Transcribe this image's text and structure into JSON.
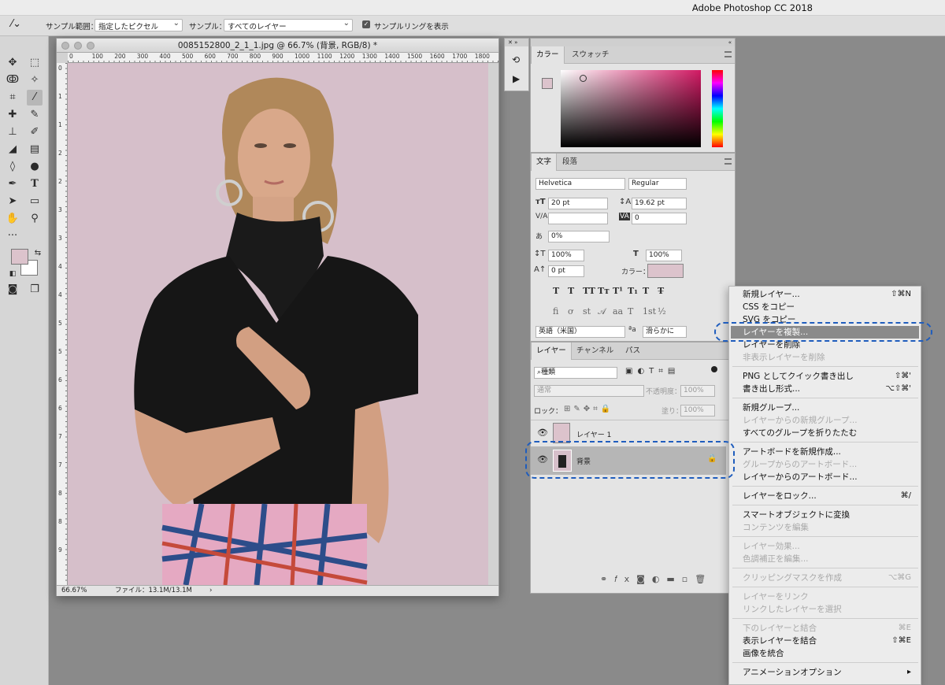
{
  "app_title": "Adobe Photoshop CC 2018",
  "options": {
    "sample_size_label": "サンプル範囲：",
    "sample_size_value": "指定したピクセル",
    "sample_label": "サンプル：",
    "sample_value": "すべてのレイヤー",
    "show_ring_label": "サンプルリングを表示"
  },
  "document": {
    "title": "0085152800_2_1_1.jpg @ 66.7% (背景, RGB/8) *",
    "zoom": "66.67%",
    "file_info": "ファイル：13.1M/13.1M",
    "ruler_h": [
      "0",
      "100",
      "200",
      "300",
      "400",
      "500",
      "600",
      "700",
      "800",
      "900",
      "1000",
      "1100",
      "1200",
      "1300",
      "1400",
      "1500",
      "1600",
      "1700",
      "1800"
    ],
    "ruler_v": [
      "0",
      "1",
      "1",
      "2",
      "2",
      "3",
      "3",
      "4",
      "4",
      "5",
      "5",
      "6",
      "6",
      "7",
      "7",
      "8",
      "8",
      "9"
    ]
  },
  "color_panel": {
    "tabs": [
      "カラー",
      "スウォッチ"
    ]
  },
  "char_panel": {
    "tabs": [
      "文字",
      "段落"
    ],
    "font_family": "Helvetica",
    "font_style": "Regular",
    "font_size": "20 pt",
    "leading": "19.62 pt",
    "kerning": "",
    "tracking": "0",
    "scale_pct": "0%",
    "v_scale": "100%",
    "h_scale": "100%",
    "baseline": "0 pt",
    "color_label": "カラー：",
    "language": "英語（米国）",
    "anti_alias": "滑らかに",
    "style_glyphs": [
      "T",
      "T",
      "TT",
      "Tт",
      "T¹",
      "T₁",
      "T",
      "T̶"
    ],
    "ot_glyphs": [
      "ﬁ",
      "ơ",
      "st",
      "𝒜",
      "aa",
      "T",
      "1st",
      "½"
    ]
  },
  "layers_panel": {
    "tabs": [
      "レイヤー",
      "チャンネル",
      "パス"
    ],
    "filter": "種類",
    "blend_mode": "通常",
    "opacity_label": "不透明度：",
    "opacity_value": "100%",
    "lock_label": "ロック：",
    "fill_label": "塗り：",
    "fill_value": "100%",
    "layers": [
      {
        "name": "レイヤー 1"
      },
      {
        "name": "背景"
      }
    ]
  },
  "context_menu": {
    "items": [
      {
        "label": "新規レイヤー...",
        "shortcut": "⇧⌘N",
        "disabled": false
      },
      {
        "label": "CSS をコピー",
        "shortcut": "",
        "disabled": false
      },
      {
        "label": "SVG をコピー",
        "shortcut": "",
        "disabled": false
      },
      {
        "label": "レイヤーを複製...",
        "shortcut": "",
        "disabled": false,
        "highlighted": true
      },
      {
        "label": "レイヤーを削除",
        "shortcut": "",
        "disabled": false
      },
      {
        "label": "非表示レイヤーを削除",
        "shortcut": "",
        "disabled": true
      },
      {
        "sep": true
      },
      {
        "label": "PNG としてクイック書き出し",
        "shortcut": "⇧⌘'",
        "disabled": false
      },
      {
        "label": "書き出し形式...",
        "shortcut": "⌥⇧⌘'",
        "disabled": false
      },
      {
        "sep": true
      },
      {
        "label": "新規グループ...",
        "shortcut": "",
        "disabled": false
      },
      {
        "label": "レイヤーからの新規グループ...",
        "shortcut": "",
        "disabled": true
      },
      {
        "label": "すべてのグループを折りたたむ",
        "shortcut": "",
        "disabled": false
      },
      {
        "sep": true
      },
      {
        "label": "アートボードを新規作成...",
        "shortcut": "",
        "disabled": false
      },
      {
        "label": "グループからのアートボード...",
        "shortcut": "",
        "disabled": true
      },
      {
        "label": "レイヤーからのアートボード...",
        "shortcut": "",
        "disabled": false
      },
      {
        "sep": true
      },
      {
        "label": "レイヤーをロック...",
        "shortcut": "⌘/",
        "disabled": false
      },
      {
        "sep": true
      },
      {
        "label": "スマートオブジェクトに変換",
        "shortcut": "",
        "disabled": false
      },
      {
        "label": "コンテンツを編集",
        "shortcut": "",
        "disabled": true
      },
      {
        "sep": true
      },
      {
        "label": "レイヤー効果...",
        "shortcut": "",
        "disabled": true
      },
      {
        "label": "色調補正を編集...",
        "shortcut": "",
        "disabled": true
      },
      {
        "sep": true
      },
      {
        "label": "クリッピングマスクを作成",
        "shortcut": "⌥⌘G",
        "disabled": true
      },
      {
        "sep": true
      },
      {
        "label": "レイヤーをリンク",
        "shortcut": "",
        "disabled": true
      },
      {
        "label": "リンクしたレイヤーを選択",
        "shortcut": "",
        "disabled": true
      },
      {
        "sep": true
      },
      {
        "label": "下のレイヤーと結合",
        "shortcut": "⌘E",
        "disabled": true
      },
      {
        "label": "表示レイヤーを結合",
        "shortcut": "⇧⌘E",
        "disabled": false
      },
      {
        "label": "画像を統合",
        "shortcut": "",
        "disabled": false
      },
      {
        "sep": true
      },
      {
        "label": "アニメーションオプション",
        "shortcut": "▸",
        "disabled": false
      }
    ]
  },
  "colors": {
    "canvas_bg": "#d6bfca",
    "swatch_fg": "#dcc3cc",
    "highlight": "#8a8a8a",
    "annotation": "#1f5dbd"
  }
}
